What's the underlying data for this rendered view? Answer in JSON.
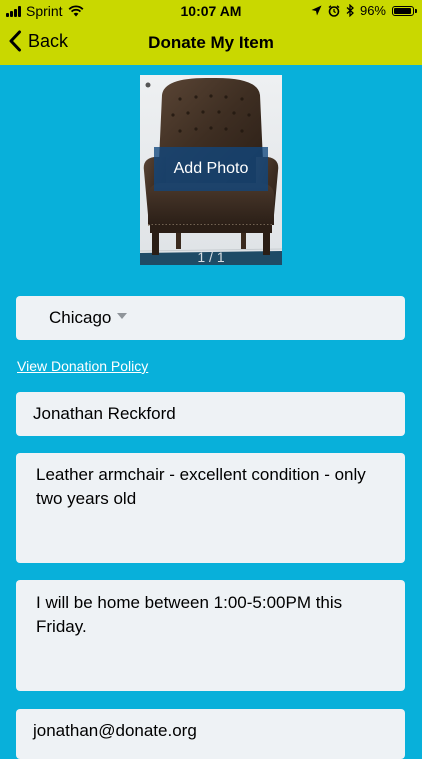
{
  "status_bar": {
    "carrier": "Sprint",
    "time": "10:07 AM",
    "battery_percent": "96%",
    "battery_level": 0.96,
    "icons": [
      "signal-icon",
      "wifi-icon",
      "location-icon",
      "alarm-icon",
      "bluetooth-icon",
      "battery-icon"
    ]
  },
  "nav": {
    "back_label": "Back",
    "title": "Donate My Item"
  },
  "photo": {
    "add_label": "Add Photo",
    "counter": "1 / 1"
  },
  "form": {
    "city": "Chicago",
    "policy_link": "View Donation Policy",
    "name": "Jonathan Reckford",
    "description": "Leather armchair - excellent condition - only two years old",
    "availability": "I will be home between 1:00-5:00PM this Friday.",
    "email": "jonathan@donate.org"
  },
  "colors": {
    "header": "#C9D800",
    "background": "#08B0DA",
    "field": "#EEF2F5",
    "photo_overlay": "#11467E"
  }
}
